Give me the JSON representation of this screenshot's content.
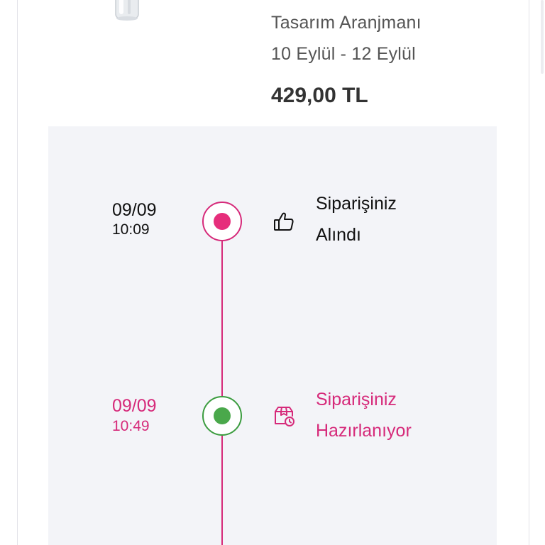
{
  "product": {
    "name": "Tasarım Aranjmanı",
    "delivery": "10 Eylül - 12 Eylül",
    "price": "429,00 TL"
  },
  "timeline": {
    "steps": [
      {
        "date": "09/09",
        "time": "10:09",
        "title_line1": "Siparişiniz",
        "title_line2": "Alındı",
        "status": "done",
        "icon": "thumbs-up-icon",
        "text_color": "#111111",
        "dot_color": "#e62e7b"
      },
      {
        "date": "09/09",
        "time": "10:49",
        "title_line1": "Siparişiniz",
        "title_line2": "Hazırlanıyor",
        "status": "current",
        "icon": "box-clock-icon",
        "text_color": "#d62a7a",
        "dot_color": "#4aa84b"
      }
    ],
    "line_color": "#d62a7a"
  },
  "colors": {
    "accent": "#d62a7a",
    "panel_bg": "#f3f4f8"
  }
}
